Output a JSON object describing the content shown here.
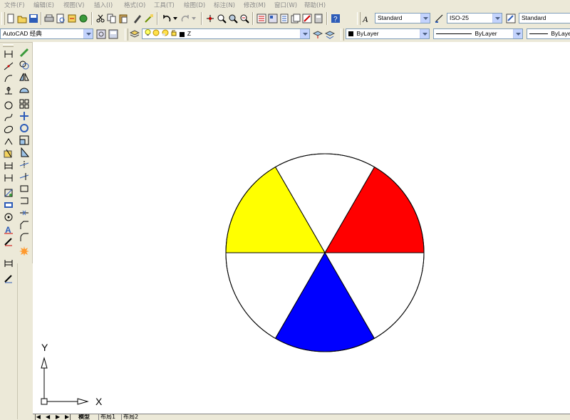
{
  "menu": {
    "items": [
      "文件(F)",
      "编辑(E)",
      "视图(V)",
      "插入(I)",
      "格式(O)",
      "工具(T)",
      "绘图(D)",
      "标注(N)",
      "修改(M)",
      "窗口(W)",
      "帮助(H)"
    ]
  },
  "toolbar_styles": {
    "text_style": "Standard",
    "dim_style": "ISO-25",
    "table_style": "Standard"
  },
  "workspace": {
    "value": "AutoCAD 经典"
  },
  "layers": {
    "current_layer": "Z",
    "color_control": "ByLayer",
    "linetype_control": "ByLayer",
    "lineweight_control": "ByLayer"
  },
  "drawing": {
    "sectors": [
      {
        "from_deg": 0,
        "to_deg": 60,
        "fill": "#ff0000"
      },
      {
        "from_deg": 60,
        "to_deg": 120,
        "fill": "#ffffff"
      },
      {
        "from_deg": 120,
        "to_deg": 180,
        "fill": "#ffff00"
      },
      {
        "from_deg": 180,
        "to_deg": 240,
        "fill": "#ffffff"
      },
      {
        "from_deg": 240,
        "to_deg": 300,
        "fill": "#0000ff"
      },
      {
        "from_deg": 300,
        "to_deg": 360,
        "fill": "#ffffff"
      }
    ]
  },
  "ucs": {
    "x_label": "X",
    "y_label": "Y"
  },
  "layout_tabs": [
    "模型",
    "布局1",
    "布局2"
  ],
  "colors": {
    "red": "#ff0000",
    "yellow": "#ffff00",
    "blue": "#0000ff",
    "chrome": "#ece9d8"
  }
}
